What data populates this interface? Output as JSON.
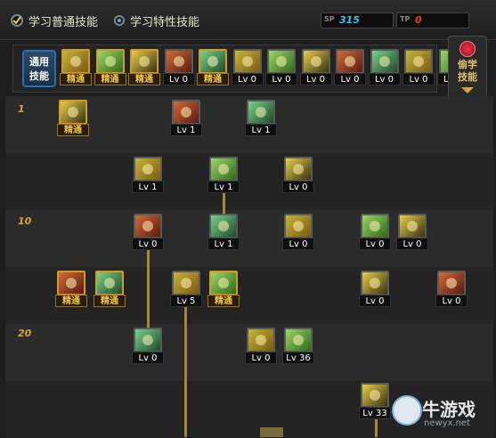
{
  "header": {
    "tab_normal": "学习普通技能",
    "tab_special": "学习特性技能",
    "sp_value": "315",
    "tp_value": "0",
    "sp_icon": "SP",
    "tp_icon": "TP"
  },
  "general": {
    "label_line1": "通用",
    "label_line2": "技能",
    "skills": [
      "精通",
      "精通",
      "精通",
      "Lv 0",
      "精通",
      "Lv 0",
      "Lv 0",
      "Lv 0",
      "Lv 0",
      "Lv 0",
      "Lv 0",
      "Lv 0"
    ]
  },
  "steal": {
    "line1": "偷学",
    "line2": "技能"
  },
  "levels": [
    "1",
    "10",
    "20"
  ],
  "tree": [
    "精通",
    "Lv 1",
    "Lv 1",
    "Lv 1",
    "Lv 1",
    "Lv 0",
    "Lv 0",
    "Lv 1",
    "Lv 0",
    "Lv 0",
    "Lv 0",
    "精通",
    "精通",
    "Lv 5",
    "精通",
    "Lv 0",
    "Lv 0",
    "Lv 0",
    "Lv 0",
    "Lv 36",
    "Lv 33"
  ],
  "watermark": {
    "title": "牛游戏",
    "url": "newyx.net"
  },
  "colors": {
    "accent": "#d29a2a",
    "sp": "#43c0e8",
    "tp": "#e0402a"
  }
}
